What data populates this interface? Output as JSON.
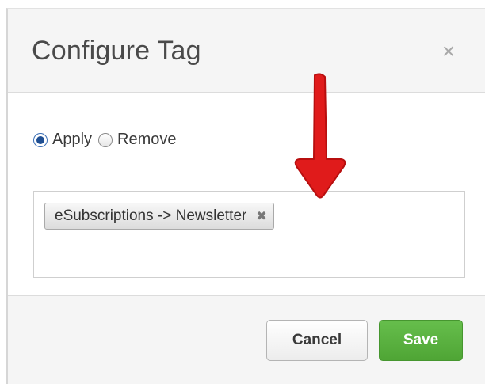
{
  "modal": {
    "title": "Configure Tag",
    "close_symbol": "×",
    "close_icon": "close-icon"
  },
  "mode": {
    "options": [
      {
        "label": "Apply",
        "checked": true
      },
      {
        "label": "Remove",
        "checked": false
      }
    ]
  },
  "tags": {
    "items": [
      {
        "label": "eSubscriptions -> Newsletter",
        "remove_symbol": "✖"
      }
    ]
  },
  "footer": {
    "cancel_label": "Cancel",
    "save_label": "Save"
  },
  "colors": {
    "save_green": "#5cb543",
    "annotation_red": "#e01b1b",
    "radio_checked_blue": "#1f4f93"
  }
}
